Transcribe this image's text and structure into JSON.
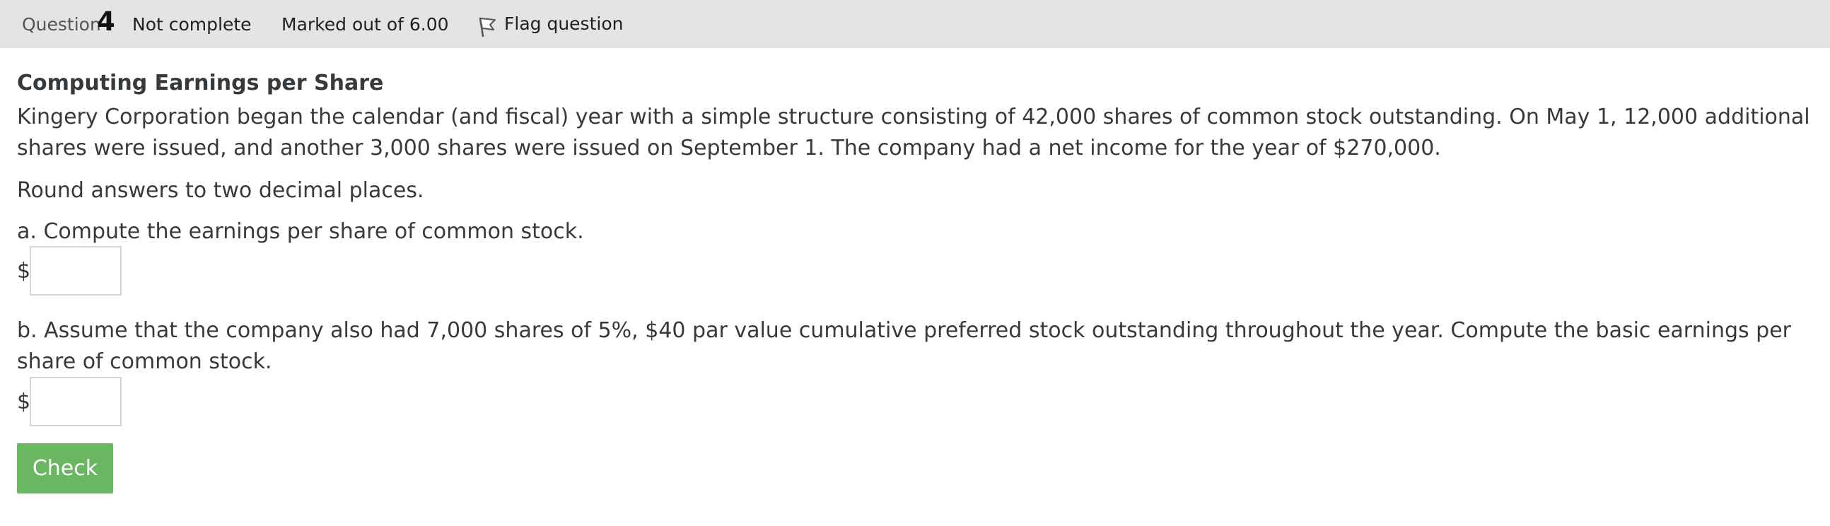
{
  "header": {
    "question_label": "Question",
    "question_number": "4",
    "state": "Not complete",
    "grade": "Marked out of 6.00",
    "flag_label": "Flag question"
  },
  "question": {
    "title": "Computing Earnings per Share",
    "intro": "Kingery Corporation began the calendar (and fiscal) year with a simple structure consisting of 42,000 shares of common stock outstanding. On May 1, 12,000 additional shares were issued, and another 3,000 shares were issued on September 1. The company had a net income for the year of $270,000.",
    "instruction": "Round answers to two decimal places.",
    "part_a": {
      "prompt": "a. Compute the earnings per share of common stock.",
      "currency": "$",
      "value": ""
    },
    "part_b": {
      "prompt": "b. Assume that the company also had 7,000 shares of 5%, $40 par value cumulative preferred stock outstanding throughout the year. Compute the basic earnings per share of common stock.",
      "currency": "$",
      "value": ""
    }
  },
  "actions": {
    "check_label": "Check"
  },
  "colors": {
    "header_bg": "#e4e4e4",
    "check_button": "#6ab762",
    "text": "#373a3c"
  },
  "icons": {
    "flag": "flag-icon"
  }
}
